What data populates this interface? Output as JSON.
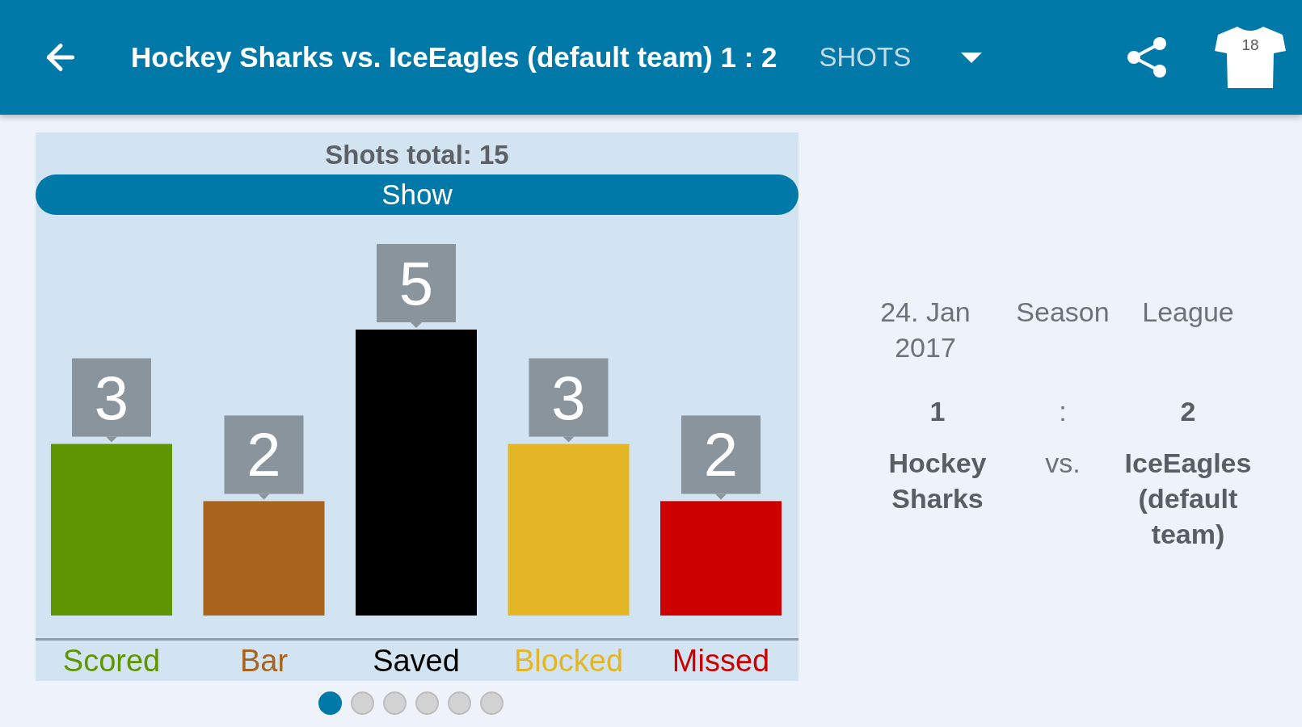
{
  "app_bar": {
    "title": "Hockey Sharks vs. IceEagles (default team) 1 : 2",
    "section": "SHOTS",
    "jersey_number": "18"
  },
  "chart_card": {
    "heading": "Shots total: 15",
    "show_button": "Show",
    "chart_data": [
      {
        "type": "bar",
        "categories": [
          "Scored",
          "Bar",
          "Saved",
          "Blocked",
          "Missed"
        ],
        "values": [
          3,
          2,
          5,
          3,
          2
        ],
        "colors": [
          "#5f9600",
          "#a8641c",
          "#000000",
          "#e4b625",
          "#cc0000"
        ],
        "data_labels": true
      }
    ]
  },
  "pager_dots": [
    {
      "selected": true
    },
    {
      "selected": false
    },
    {
      "selected": false
    },
    {
      "selected": false
    },
    {
      "selected": false
    },
    {
      "selected": false
    }
  ],
  "match_info": {
    "date": "24. Jan 2017",
    "season": "Season",
    "league": "League",
    "home_score": "1",
    "score_separator": ":",
    "away_score": "2",
    "home_team": "Hockey Sharks",
    "versus": "vs.",
    "away_team": "IceEagles (default team)"
  }
}
